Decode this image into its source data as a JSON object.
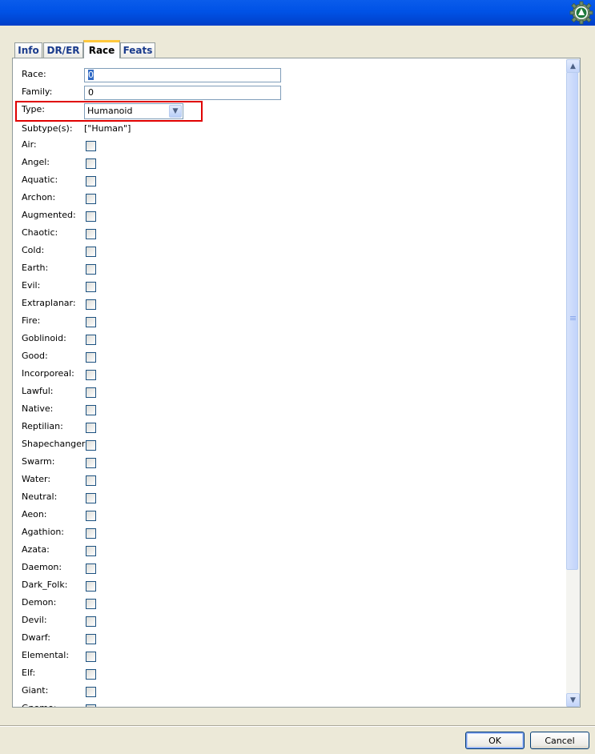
{
  "tabs": [
    {
      "label": "Info"
    },
    {
      "label": "DR/ER"
    },
    {
      "label": "Race",
      "active": true
    },
    {
      "label": "Feats"
    }
  ],
  "form": {
    "race_label": "Race:",
    "race_value": "0",
    "family_label": "Family:",
    "family_value": "0",
    "type_label": "Type:",
    "type_value": "Humanoid",
    "subtypes_label": "Subtype(s):",
    "subtypes_value": "[\"Human\"]"
  },
  "subtypes": [
    {
      "label": "Air:",
      "checked": false
    },
    {
      "label": "Angel:",
      "checked": false
    },
    {
      "label": "Aquatic:",
      "checked": false
    },
    {
      "label": "Archon:",
      "checked": false
    },
    {
      "label": "Augmented:",
      "checked": false
    },
    {
      "label": "Chaotic:",
      "checked": false
    },
    {
      "label": "Cold:",
      "checked": false
    },
    {
      "label": "Earth:",
      "checked": false
    },
    {
      "label": "Evil:",
      "checked": false
    },
    {
      "label": "Extraplanar:",
      "checked": false
    },
    {
      "label": "Fire:",
      "checked": false
    },
    {
      "label": "Goblinoid:",
      "checked": false
    },
    {
      "label": "Good:",
      "checked": false
    },
    {
      "label": "Incorporeal:",
      "checked": false
    },
    {
      "label": "Lawful:",
      "checked": false
    },
    {
      "label": "Native:",
      "checked": false
    },
    {
      "label": "Reptilian:",
      "checked": false
    },
    {
      "label": "Shapechanger:",
      "checked": false
    },
    {
      "label": "Swarm:",
      "checked": false
    },
    {
      "label": "Water:",
      "checked": false
    },
    {
      "label": "Neutral:",
      "checked": false
    },
    {
      "label": "Aeon:",
      "checked": false
    },
    {
      "label": "Agathion:",
      "checked": false
    },
    {
      "label": "Azata:",
      "checked": false
    },
    {
      "label": "Daemon:",
      "checked": false
    },
    {
      "label": "Dark_Folk:",
      "checked": false
    },
    {
      "label": "Demon:",
      "checked": false
    },
    {
      "label": "Devil:",
      "checked": false
    },
    {
      "label": "Dwarf:",
      "checked": false
    },
    {
      "label": "Elemental:",
      "checked": false
    },
    {
      "label": "Elf:",
      "checked": false
    },
    {
      "label": "Giant:",
      "checked": false
    },
    {
      "label": "Gnome:",
      "checked": false
    }
  ],
  "buttons": {
    "ok_label": "OK",
    "cancel_label": "Cancel"
  },
  "icons": {
    "gear": "gear-icon",
    "scroll_up": "arrow-up-icon",
    "scroll_down": "arrow-down-icon",
    "dropdown": "chevron-down-icon"
  },
  "colors": {
    "title_bar": "#0052E6",
    "highlight": "#E00000",
    "active_tab_accent": "#FFC83C"
  }
}
